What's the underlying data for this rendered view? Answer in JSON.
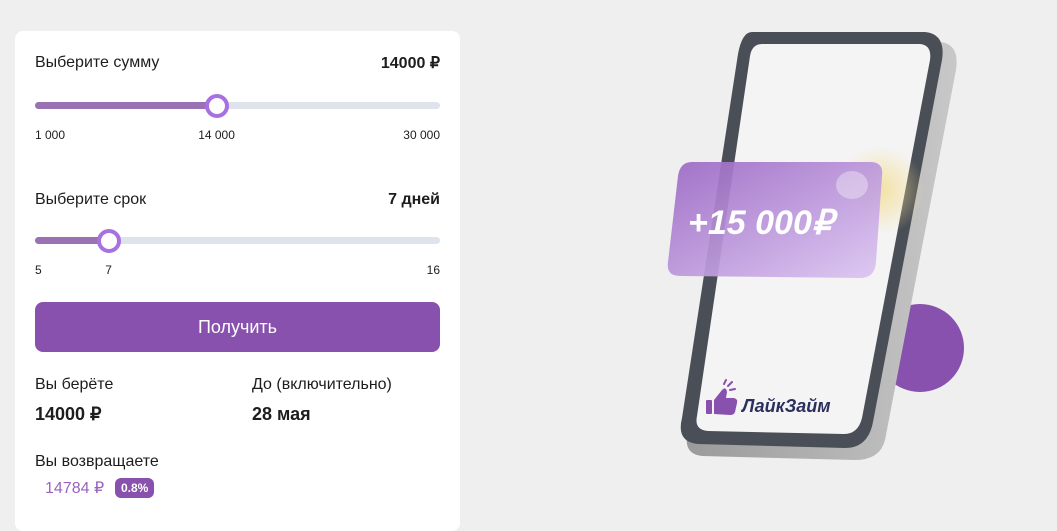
{
  "calculator": {
    "amount": {
      "label": "Выберите сумму",
      "value_display": "14000 ₽",
      "min": 1000,
      "max": 30000,
      "value": 14000,
      "tick_min": "1 000",
      "tick_value": "14 000",
      "tick_max": "30 000"
    },
    "term": {
      "label": "Выберите срок",
      "value_display": "7 дней",
      "min": 5,
      "max": 16,
      "value": 7,
      "tick_min": "5",
      "tick_value": "7",
      "tick_max": "16"
    },
    "submit_label": "Получить",
    "take": {
      "label": "Вы берёте",
      "value": "14000 ₽"
    },
    "until": {
      "label": "До (включительно)",
      "value": "28 мая"
    },
    "return": {
      "label": "Вы возвращаете",
      "value": "14784 ₽",
      "rate_badge": "0.8%"
    }
  },
  "promo": {
    "amount_text": "+15 000₽",
    "brand_name": "ЛайкЗайм"
  },
  "colors": {
    "accent": "#8751ad",
    "slider_fill": "#9a72b4",
    "thumb_border": "#a871e0",
    "track": "#dfe3ec"
  }
}
